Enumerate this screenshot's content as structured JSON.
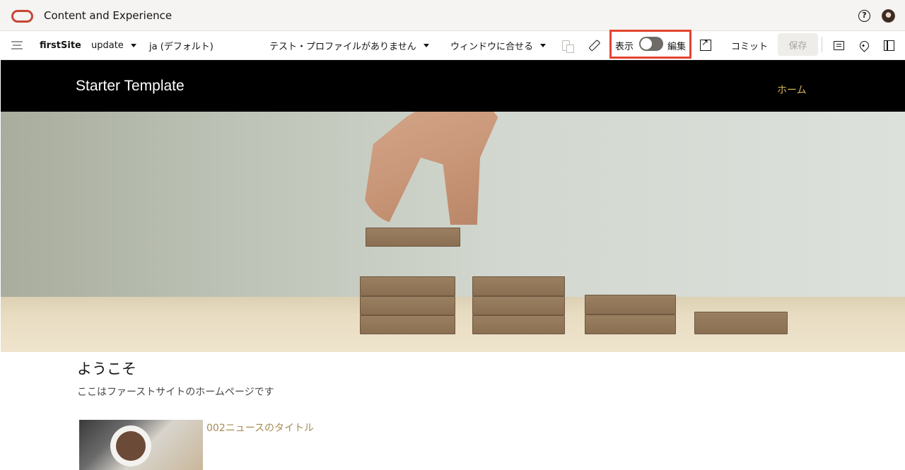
{
  "global_header": {
    "app_title": "Content and Experience",
    "help_icon": "question-circle-icon",
    "avatar": "user-avatar"
  },
  "toolbar": {
    "site_name": "firstSite",
    "update_label": "update",
    "language_label": "ja (デフォルト)",
    "profile_label": "テスト・プロファイルがありません",
    "fit_label": "ウィンドウに合せる",
    "view_label": "表示",
    "edit_label": "編集",
    "mode_toggle": "off",
    "commit_label": "コミット",
    "save_label": "保存",
    "icons": [
      "menu-icon",
      "device-preview-icon",
      "ruler-icon",
      "popout-icon",
      "comment-icon",
      "pin-icon",
      "side-panel-icon"
    ],
    "highlight_color": "#e5442f"
  },
  "site": {
    "title": "Starter Template",
    "nav_home": "ホーム",
    "nav_color": "#d4b35a",
    "welcome_title": "ようこそ",
    "welcome_text": "ここはファーストサイトのホームページです",
    "news_title": "002ニュースのタイトル",
    "news_title_color": "#a48a52"
  }
}
